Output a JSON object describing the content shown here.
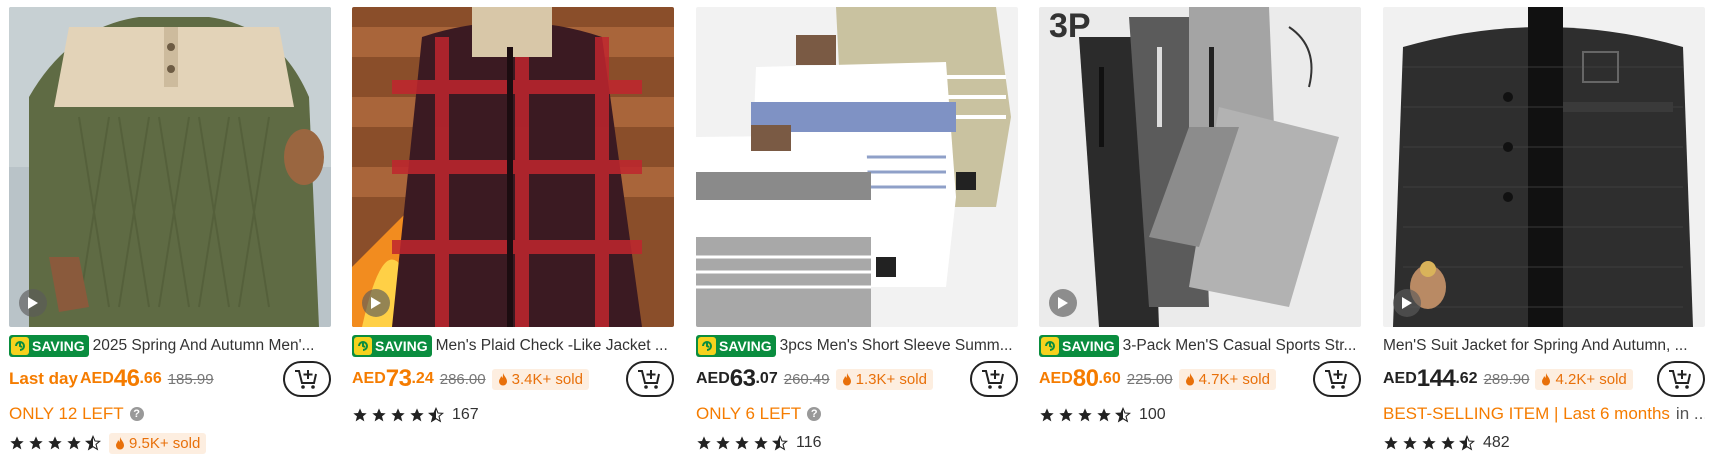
{
  "products": [
    {
      "title": "2025 Spring And Autumn Men'...",
      "saving_badge": "SAVING",
      "last_day": "Last day",
      "currency": "AED",
      "price_main": "46",
      "price_dec": ".66",
      "original_price": "185.99",
      "cart_icon": "add-to-cart-icon",
      "stock_text": "ONLY 12 LEFT",
      "rating_stars": 4.5,
      "sold": "9.5K+ sold"
    },
    {
      "title": "Men's Plaid Check -Like Jacket ...",
      "saving_badge": "SAVING",
      "currency": "AED",
      "price_main": "73",
      "price_dec": ".24",
      "original_price": "286.00",
      "sold": "3.4K+ sold",
      "cart_icon": "add-to-cart-icon",
      "rating_stars": 4.5,
      "rating_count": "167"
    },
    {
      "title": "3pcs Men's Short Sleeve Summ...",
      "saving_badge": "SAVING",
      "currency": "AED",
      "price_main": "63",
      "price_dec": ".07",
      "original_price": "260.49",
      "sold": "1.3K+ sold",
      "cart_icon": "add-to-cart-icon",
      "stock_text": "ONLY 6 LEFT",
      "rating_stars": 4.5,
      "rating_count": "116"
    },
    {
      "title": "3-Pack Men'S Casual Sports Str...",
      "saving_badge": "SAVING",
      "currency": "AED",
      "price_main": "80",
      "price_dec": ".60",
      "original_price": "225.00",
      "sold": "4.7K+ sold",
      "cart_icon": "add-to-cart-icon",
      "rating_stars": 4.5,
      "rating_count": "100"
    },
    {
      "title": "Men'S Suit Jacket for Spring And Autumn, ...",
      "currency": "AED",
      "price_main": "144",
      "price_dec": ".62",
      "original_price": "289.90",
      "sold": "4.2K+ sold",
      "cart_icon": "add-to-cart-icon",
      "bestselling": "BEST-SELLING ITEM | Last 6 months",
      "bestselling_suffix": "in ...",
      "rating_stars": 4.5,
      "rating_count": "482"
    }
  ],
  "colors": {
    "accent_orange": "#f57c00",
    "saving_green": "#0a8d3f",
    "sold_bg": "#fdeee0"
  }
}
